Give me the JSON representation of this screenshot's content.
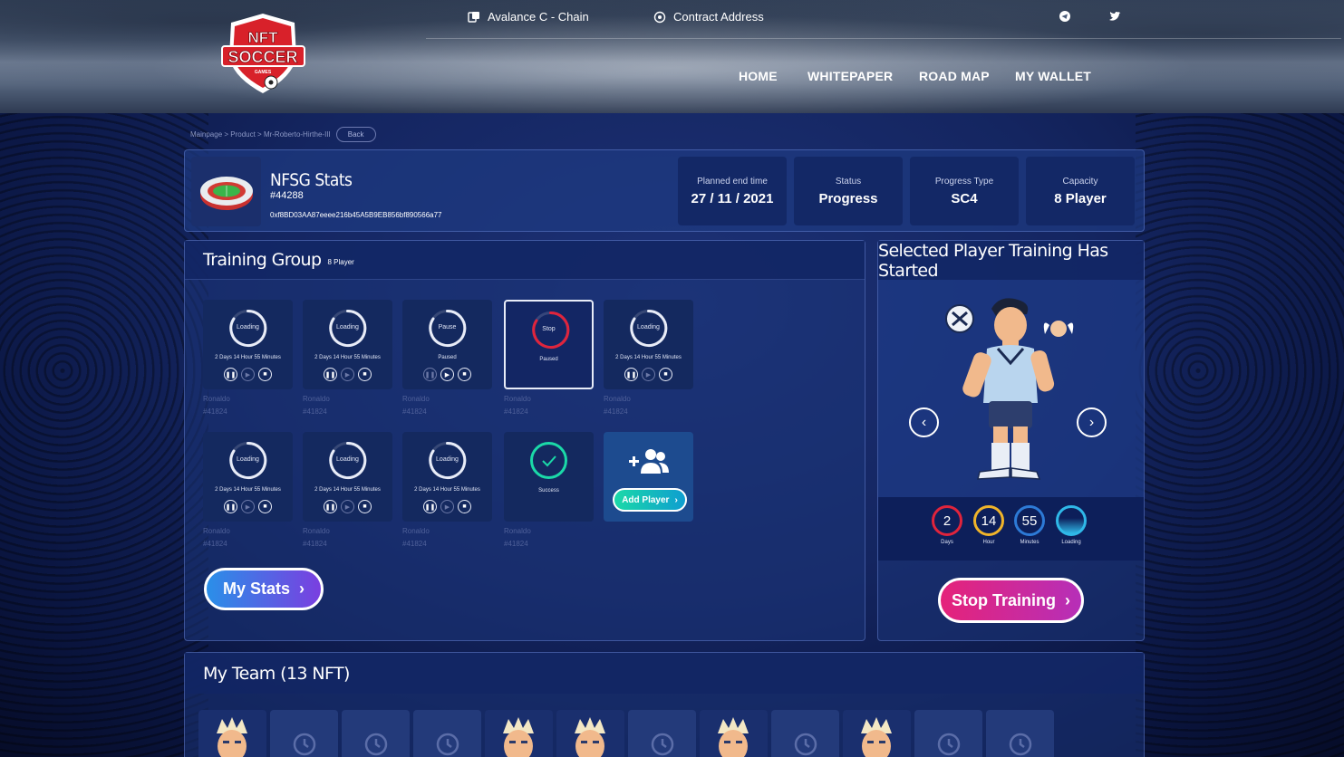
{
  "header": {
    "logo_text_top": "NFT",
    "logo_text_main": "SOCCER",
    "logo_text_sub": "GAMES",
    "chain_label": "Avalance C - Chain",
    "contract_label": "Contract Address",
    "nav": [
      "HOME",
      "WHITEPAPER",
      "ROAD MAP",
      "MY WALLET"
    ],
    "social_icons": [
      "telegram-icon",
      "twitter-icon"
    ]
  },
  "breadcrumb": {
    "path": "Mainpage > Product > Mr-Roberto-Hirthe-III",
    "back_label": "Back"
  },
  "stats": {
    "title": "NFSG Stats",
    "id": "#44288",
    "hash": "0xf8BD03AA87eeee216b45A5B9EB856bf890566a77",
    "boxes": [
      {
        "label": "Planned end time",
        "value": "27 / 11 / 2021"
      },
      {
        "label": "Status",
        "value": "Progress"
      },
      {
        "label": "Progress Type",
        "value": "SC4"
      },
      {
        "label": "Capacity",
        "value": "8 Player"
      }
    ]
  },
  "training": {
    "title": "Training Group",
    "subtitle": "8 Player",
    "cards": [
      {
        "status": "Loading",
        "time": "2 Days 14 Hour 55 Minutes",
        "name": "Ronaldo",
        "id": "#41824"
      },
      {
        "status": "Loading",
        "time": "2 Days 14 Hour 55 Minutes",
        "name": "Ronaldo",
        "id": "#41824"
      },
      {
        "status": "Pause",
        "time": "Paused",
        "name": "Ronaldo",
        "id": "#41824"
      },
      {
        "status": "Stop",
        "time": "Paused",
        "name": "Ronaldo",
        "id": "#41824"
      },
      {
        "status": "Loading",
        "time": "2 Days 14 Hour 55 Minutes",
        "name": "Ronaldo",
        "id": "#41824"
      },
      {
        "status": "Loading",
        "time": "2 Days 14 Hour 55 Minutes",
        "name": "Ronaldo",
        "id": "#41824"
      },
      {
        "status": "Loading",
        "time": "2 Days 14 Hour 55 Minutes",
        "name": "Ronaldo",
        "id": "#41824"
      },
      {
        "status": "Loading",
        "time": "2 Days 14 Hour 55 Minutes",
        "name": "Ronaldo",
        "id": "#41824"
      },
      {
        "status": "Success",
        "time": "",
        "name": "Ronaldo",
        "id": "#41824"
      }
    ],
    "add_player_label": "Add Player",
    "my_stats_label": "My Stats"
  },
  "player": {
    "title": "Selected Player Training Has Started",
    "timers": [
      {
        "value": "2",
        "label": "Days",
        "color": "#e0243c"
      },
      {
        "value": "14",
        "label": "Hour",
        "color": "#f0b42a"
      },
      {
        "value": "55",
        "label": "Minutes",
        "color": "#2d7ad6"
      },
      {
        "value": "",
        "label": "Loading",
        "color": "#2fb8e8"
      }
    ],
    "stop_label": "Stop Training"
  },
  "team": {
    "title": "My Team (13 NFT)",
    "cards": [
      "player",
      "empty",
      "empty",
      "empty",
      "player",
      "player",
      "empty",
      "player",
      "empty",
      "player",
      "empty",
      "empty"
    ]
  },
  "colors": {
    "accent_green": "#1bd9a8",
    "accent_pink": "#e5237a",
    "accent_blue": "#2a8fe8"
  }
}
